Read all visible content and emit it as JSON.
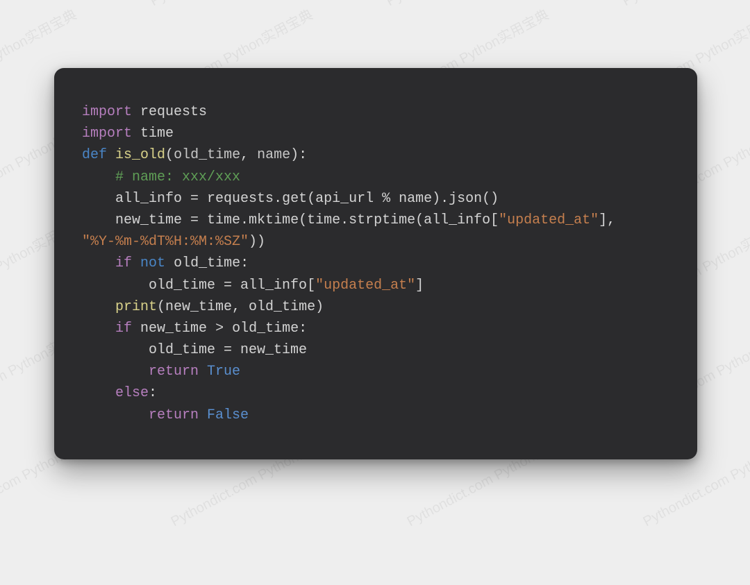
{
  "watermark_text": "Pythondict.com Python实用宝典",
  "code": {
    "l1": {
      "kw": "import",
      "mod": "requests"
    },
    "l2": {
      "kw": "import",
      "mod": "time"
    },
    "l3": {
      "kw": "def",
      "fn": "is_old",
      "p1": "old_time",
      "p2": "name"
    },
    "l4": {
      "comment": "# name: xxx/xxx"
    },
    "l5": {
      "lhs": "all_info",
      "eq": " = ",
      "a": "requests.get(api_url % name).json()"
    },
    "l6": {
      "lhs": "new_time",
      "eq": " = ",
      "a": "time.mktime(time.strptime(all_info[",
      "s": "\"updated_at\"",
      "b": "],"
    },
    "l7": {
      "s": "\"%Y-%m-%dT%H:%M:%SZ\"",
      "b": "))"
    },
    "l8": {
      "kw_if": "if",
      "kw_not": "not",
      "cond": "old_time:"
    },
    "l9": {
      "lhs": "old_time",
      "eq": " = ",
      "a": "all_info[",
      "s": "\"updated_at\"",
      "b": "]"
    },
    "l10": {
      "fn": "print",
      "args": "(new_time, old_time)"
    },
    "l11": {
      "kw_if": "if",
      "cond": "new_time > old_time:"
    },
    "l12": {
      "lhs": "old_time",
      "eq": " = ",
      "rhs": "new_time"
    },
    "l13": {
      "kw": "return",
      "val": "True"
    },
    "l14": {
      "kw": "else",
      "colon": ":"
    },
    "l15": {
      "kw": "return",
      "val": "False"
    }
  }
}
